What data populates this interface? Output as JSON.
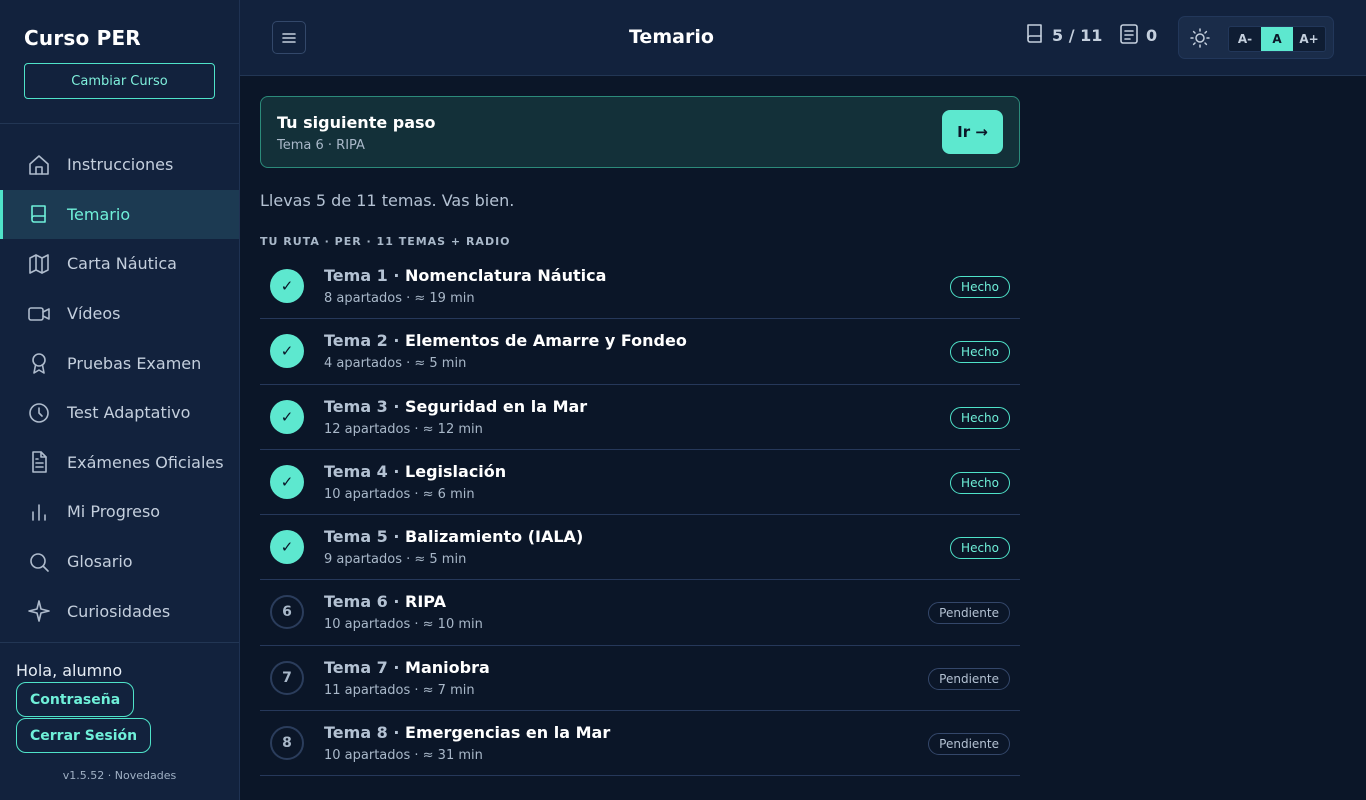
{
  "sidebar": {
    "title": "Curso PER",
    "change_course_label": "Cambiar Curso",
    "items": [
      {
        "label": "Instrucciones",
        "icon": "home-icon"
      },
      {
        "label": "Temario",
        "icon": "book-icon",
        "active": true
      },
      {
        "label": "Carta Náutica",
        "icon": "map-icon"
      },
      {
        "label": "Vídeos",
        "icon": "video-icon"
      },
      {
        "label": "Pruebas Examen",
        "icon": "award-icon"
      },
      {
        "label": "Test Adaptativo",
        "icon": "clock-icon"
      },
      {
        "label": "Exámenes Oficiales",
        "icon": "file-text-icon"
      },
      {
        "label": "Mi Progreso",
        "icon": "bar-chart-icon"
      },
      {
        "label": "Glosario",
        "icon": "search-icon"
      },
      {
        "label": "Curiosidades",
        "icon": "sparkle-icon"
      }
    ],
    "greeting": "Hola, alumno",
    "password_label": "Contraseña",
    "logout_label": "Cerrar Sesión",
    "version": "v1.5.52 · Novedades"
  },
  "topbar": {
    "title": "Temario",
    "topics_progress": "5 / 11",
    "notes_count": "0",
    "font_small": "A-",
    "font_normal": "A",
    "font_large": "A+"
  },
  "next_step": {
    "title": "Tu siguiente paso",
    "subtitle": "Tema 6 · RIPA",
    "button_label": "Ir →"
  },
  "progress_text": "Llevas 5 de 11 temas. Vas bien.",
  "route_label": "TU RUTA · PER · 11 TEMAS + RADIO",
  "topics": [
    {
      "num": "Tema 1",
      "name": "Nomenclatura Náutica",
      "meta": "8 apartados · ≈ 19 min",
      "status": "Hecho",
      "marker": "✓"
    },
    {
      "num": "Tema 2",
      "name": "Elementos de Amarre y Fondeo",
      "meta": "4 apartados · ≈ 5 min",
      "status": "Hecho",
      "marker": "✓"
    },
    {
      "num": "Tema 3",
      "name": "Seguridad en la Mar",
      "meta": "12 apartados · ≈ 12 min",
      "status": "Hecho",
      "marker": "✓"
    },
    {
      "num": "Tema 4",
      "name": "Legislación",
      "meta": "10 apartados · ≈ 6 min",
      "status": "Hecho",
      "marker": "✓"
    },
    {
      "num": "Tema 5",
      "name": "Balizamiento (IALA)",
      "meta": "9 apartados · ≈ 5 min",
      "status": "Hecho",
      "marker": "✓"
    },
    {
      "num": "Tema 6",
      "name": "RIPA",
      "meta": "10 apartados · ≈ 10 min",
      "status": "Pendiente",
      "marker": "6"
    },
    {
      "num": "Tema 7",
      "name": "Maniobra",
      "meta": "11 apartados · ≈ 7 min",
      "status": "Pendiente",
      "marker": "7"
    },
    {
      "num": "Tema 8",
      "name": "Emergencias en la Mar",
      "meta": "10 apartados · ≈ 31 min",
      "status": "Pendiente",
      "marker": "8"
    }
  ],
  "colors": {
    "accent": "#5de8cf",
    "background": "#0b1628",
    "sidebar": "#12223d"
  }
}
